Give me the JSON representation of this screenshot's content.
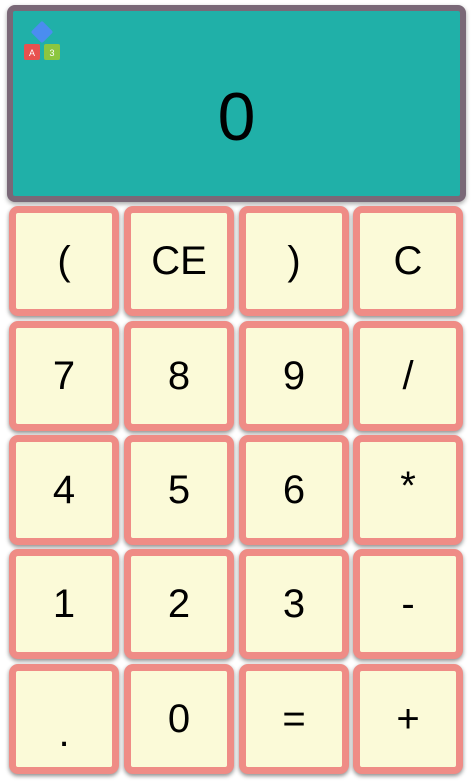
{
  "display": {
    "value": "0",
    "background": "#20b0a8",
    "frame_color": "#7a6877"
  },
  "logo": {
    "icon": "blocks-logo-icon",
    "letters": [
      "A",
      "B",
      "3"
    ]
  },
  "keypad": {
    "key_background": "#fbfad8",
    "key_border": "#ef8c86",
    "rows": [
      [
        "(",
        "CE",
        ")",
        "C"
      ],
      [
        "7",
        "8",
        "9",
        "/"
      ],
      [
        "4",
        "5",
        "6",
        "*"
      ],
      [
        "1",
        "2",
        "3",
        "-"
      ],
      [
        ".",
        "0",
        "=",
        "+"
      ]
    ]
  }
}
